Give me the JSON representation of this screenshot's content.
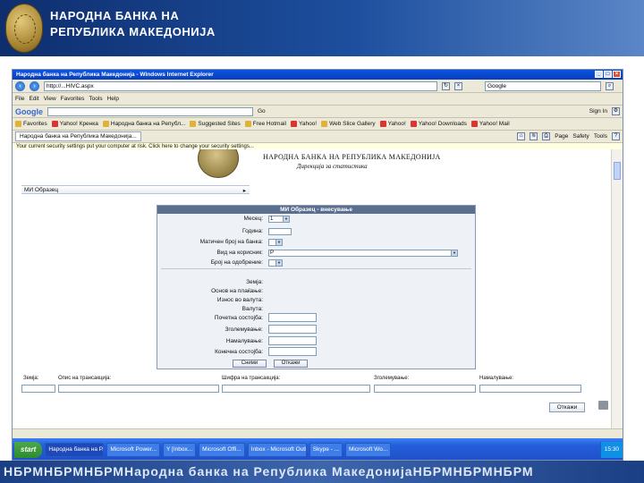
{
  "slide": {
    "bank_line1": "НАРОДНА БАНКА НА",
    "bank_line2": "РЕПУБЛИКА МАКЕДОНИЈА",
    "footer": "НБРМНБРМНБРМНародна банка на Република МакедонијаНБРМНБРМНБРМ"
  },
  "browser": {
    "title": "Народна банка на Република Македонија - Windows Internet Explorer",
    "address": "http://...HIVC.aspx",
    "search_value": "Google",
    "menu": [
      "File",
      "Edit",
      "View",
      "Favorites",
      "Tools",
      "Help"
    ],
    "toolbar": {
      "google_label": "Google",
      "go_label": "Go",
      "signin_label": "Sign In"
    },
    "favorites": [
      "Favorites",
      "Yahoo! Кренка",
      "Народна банка на Републ...",
      "Suggested Sites",
      "Free Hotmail",
      "Yahoo!",
      "Web Slice Gallery",
      "Yahoo!",
      "Yahoo! Downloads",
      "Yahoo! Mail"
    ],
    "tab_label": "Народна банка на Република Македонија...",
    "cmd_items": [
      "Page",
      "Safety",
      "Tools"
    ],
    "infobar": "Your current security settings put your computer at risk. Click here to change your security settings..."
  },
  "page": {
    "title": "НАРОДНА БАНКА НА РЕПУБЛИКА МАКЕДОНИЈА",
    "subtitle": "Дирекција за статистика",
    "menu_label": "МИ Образец",
    "menu_arrow": "▸",
    "form_title": "МИ Образец - внесување",
    "fields": {
      "month_label": "Месец:",
      "month_value": "1",
      "year_label": "Година:",
      "embs_label": "Матичен број на банка:",
      "user_label": "Вид на корисник:",
      "user_value": "Р",
      "business_label": "Број на одобрение:",
      "country_label": "Земја:",
      "basis_label": "Основ на плаќање:",
      "amount_label": "Износ во валута:",
      "currency_label": "Валута:",
      "initial_label": "Почетна состојба:",
      "increase_label": "Зголемување:",
      "decrease_label": "Намалување:",
      "final_label": "Конечна состојба:"
    },
    "form_buttons": [
      "Сними",
      "Откажи"
    ],
    "bottom_labels": [
      "Земја:",
      "Опис на трансакција:",
      "Шифра на трансакција:",
      "Зголемување:",
      "Намалување:"
    ],
    "page_button": "Откажи"
  },
  "taskbar": {
    "start": "start",
    "items": [
      "Народна банка на Р...",
      "Microsoft Power...",
      "Y [Inbox...",
      "Microsoft Offi...",
      "Inbox - Microsoft Outl...",
      "Skype - ...",
      "Microsoft Wo..."
    ],
    "clock": "15:30"
  }
}
